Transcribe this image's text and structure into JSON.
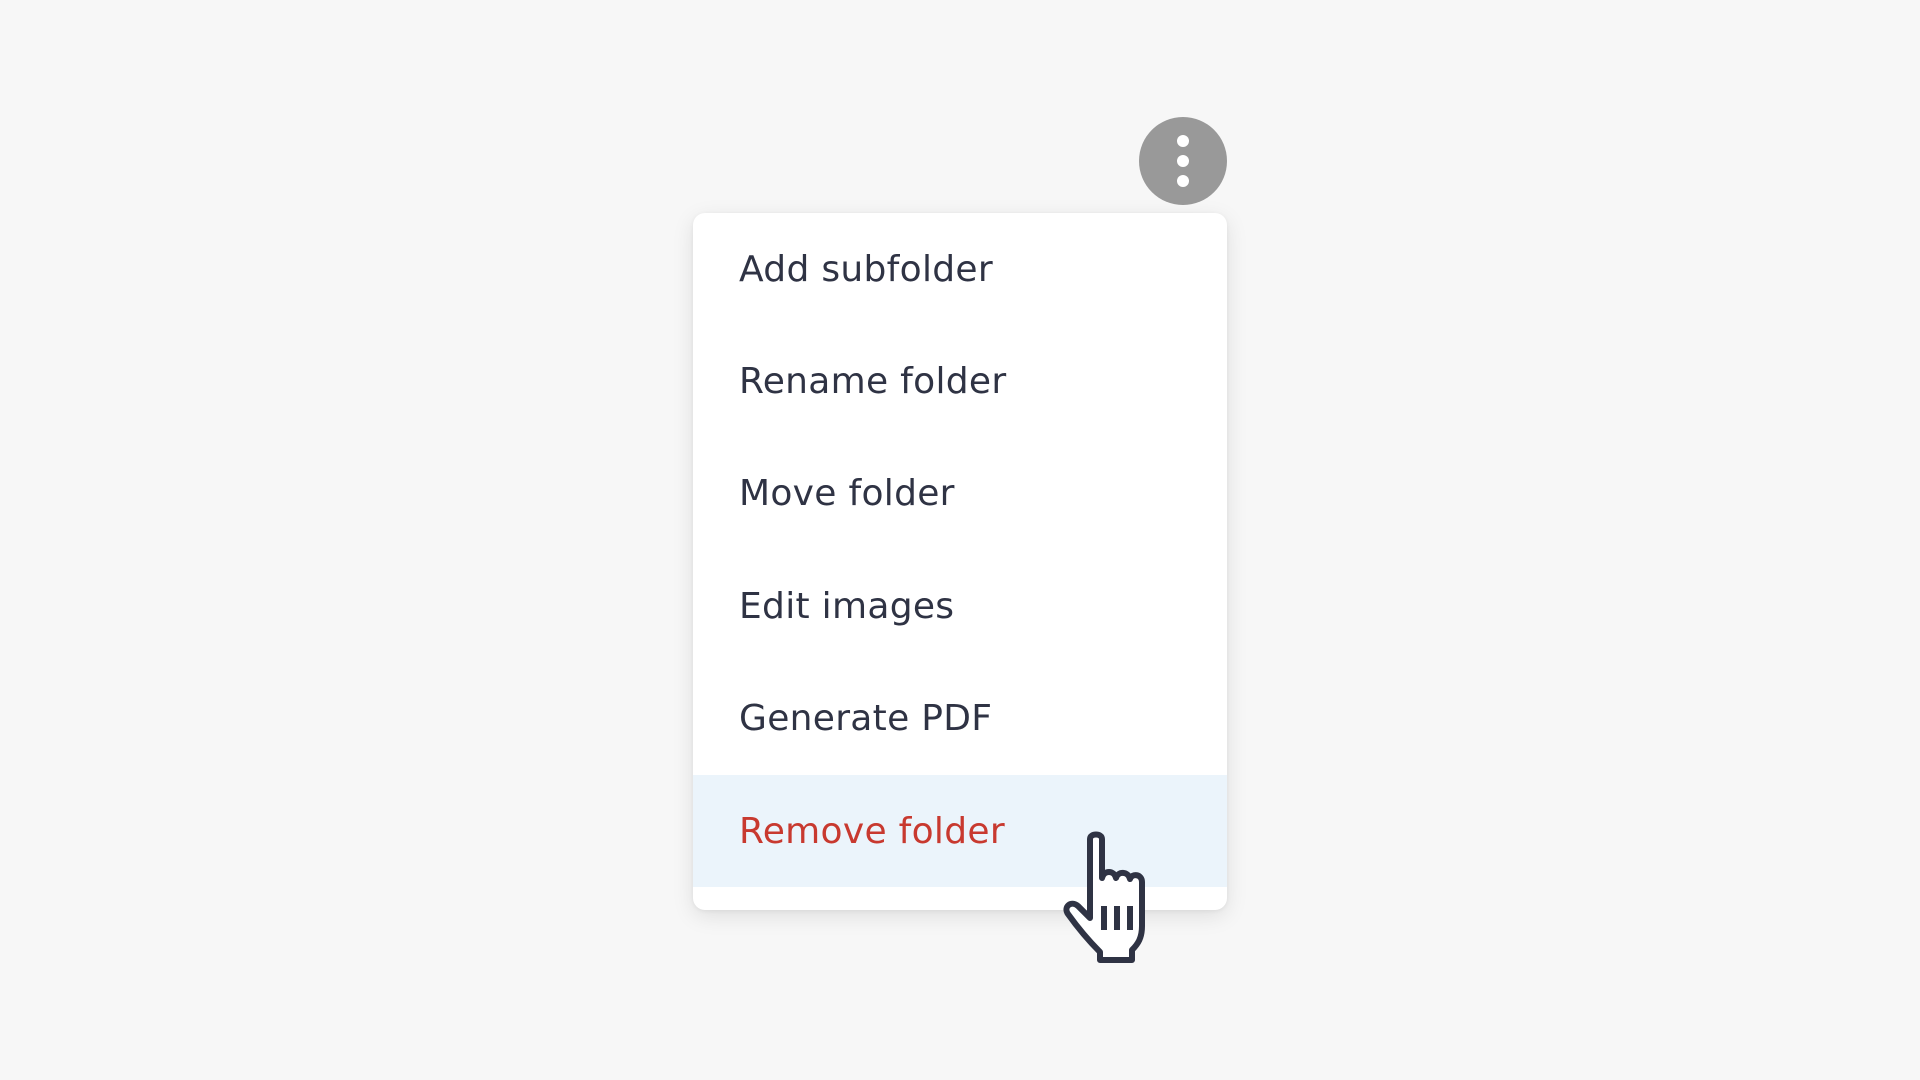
{
  "more_button": {
    "icon": "more-vertical-icon",
    "background": "#999999"
  },
  "menu": {
    "items": [
      {
        "label": "Add subfolder",
        "style": "default"
      },
      {
        "label": "Rename folder",
        "style": "default"
      },
      {
        "label": "Move folder",
        "style": "default"
      },
      {
        "label": "Edit images",
        "style": "default"
      },
      {
        "label": "Generate PDF",
        "style": "default"
      },
      {
        "label": "Remove folder",
        "style": "danger",
        "hovered": true
      }
    ]
  },
  "colors": {
    "background": "#f7f7f7",
    "text": "#2f3344",
    "danger_text": "#c8392f",
    "hover_background": "#ebf4fb"
  },
  "cursor": {
    "icon": "hand-pointer-cursor-icon"
  }
}
